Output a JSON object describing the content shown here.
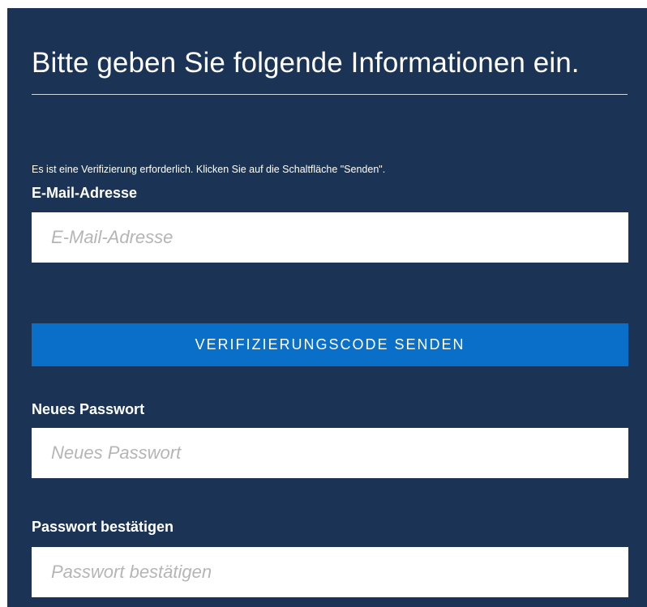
{
  "form": {
    "heading": "Bitte geben Sie folgende Informationen ein.",
    "verification_notice": "Es ist eine Verifizierung erforderlich. Klicken Sie auf die Schaltfläche \"Senden\".",
    "email": {
      "label": "E-Mail-Adresse",
      "placeholder": "E-Mail-Adresse",
      "value": ""
    },
    "send_code_button": {
      "label": "VERIFIZIERUNGSCODE SENDEN"
    },
    "new_password": {
      "label": "Neues Passwort",
      "placeholder": "Neues Passwort",
      "value": ""
    },
    "confirm_password": {
      "label": "Passwort bestätigen",
      "placeholder": "Passwort bestätigen",
      "value": ""
    }
  },
  "colors": {
    "panel_background": "#1b3455",
    "button_background": "#0a6fc9",
    "text": "#ffffff",
    "placeholder": "#b5b5b5"
  }
}
